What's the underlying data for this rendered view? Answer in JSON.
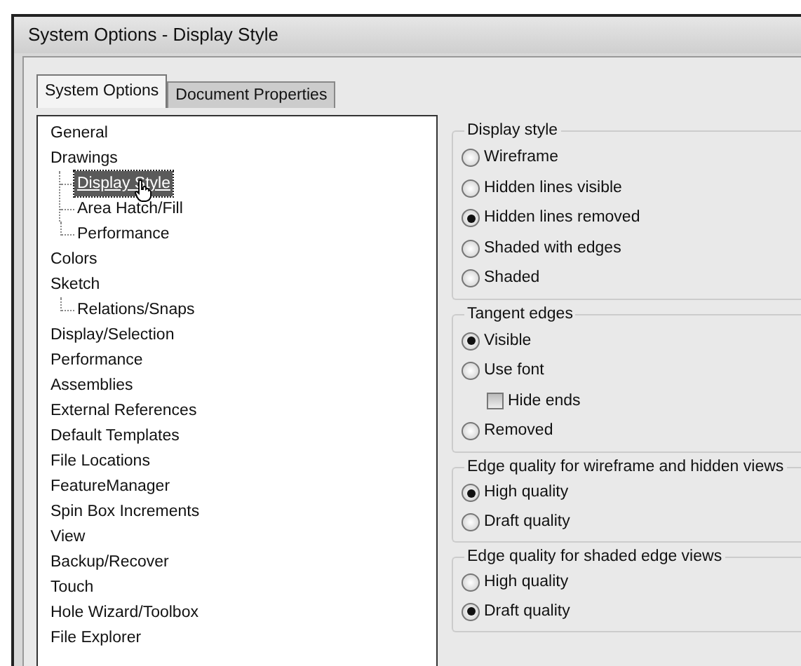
{
  "window": {
    "title": "System Options - Display Style"
  },
  "tabs": [
    {
      "label": "System Options",
      "selected": true
    },
    {
      "label": "Document Properties",
      "selected": false
    }
  ],
  "tree": [
    {
      "label": "General",
      "selected": false
    },
    {
      "label": "Drawings",
      "selected": false,
      "children": [
        {
          "label": "Display Style",
          "selected": true
        },
        {
          "label": "Area Hatch/Fill",
          "selected": false
        },
        {
          "label": "Performance",
          "selected": false
        }
      ]
    },
    {
      "label": "Colors",
      "selected": false
    },
    {
      "label": "Sketch",
      "selected": false,
      "children": [
        {
          "label": "Relations/Snaps",
          "selected": false
        }
      ]
    },
    {
      "label": "Display/Selection",
      "selected": false
    },
    {
      "label": "Performance",
      "selected": false
    },
    {
      "label": "Assemblies",
      "selected": false
    },
    {
      "label": "External References",
      "selected": false
    },
    {
      "label": "Default Templates",
      "selected": false
    },
    {
      "label": "File Locations",
      "selected": false
    },
    {
      "label": "FeatureManager",
      "selected": false
    },
    {
      "label": "Spin Box Increments",
      "selected": false
    },
    {
      "label": "View",
      "selected": false
    },
    {
      "label": "Backup/Recover",
      "selected": false
    },
    {
      "label": "Touch",
      "selected": false
    },
    {
      "label": "Hole Wizard/Toolbox",
      "selected": false
    },
    {
      "label": "File Explorer",
      "selected": false
    }
  ],
  "groups": [
    {
      "title": "Display style",
      "options": [
        {
          "kind": "radio",
          "label": "Wireframe",
          "checked": false
        },
        {
          "kind": "radio",
          "label": "Hidden lines visible",
          "checked": false
        },
        {
          "kind": "radio",
          "label": "Hidden lines removed",
          "checked": true
        },
        {
          "kind": "radio",
          "label": "Shaded with edges",
          "checked": false
        },
        {
          "kind": "radio",
          "label": "Shaded",
          "checked": false
        }
      ]
    },
    {
      "title": "Tangent edges",
      "options": [
        {
          "kind": "radio",
          "label": "Visible",
          "checked": true
        },
        {
          "kind": "radio",
          "label": "Use font",
          "checked": false
        },
        {
          "kind": "checkbox",
          "label": "Hide ends",
          "checked": false
        },
        {
          "kind": "radio",
          "label": "Removed",
          "checked": false
        }
      ]
    },
    {
      "title": "Edge quality for wireframe and hidden views",
      "options": [
        {
          "kind": "radio",
          "label": "High quality",
          "checked": true
        },
        {
          "kind": "radio",
          "label": "Draft quality",
          "checked": false
        }
      ]
    },
    {
      "title": "Edge quality for shaded edge views",
      "options": [
        {
          "kind": "radio",
          "label": "High quality",
          "checked": false
        },
        {
          "kind": "radio",
          "label": "Draft quality",
          "checked": true
        }
      ]
    }
  ]
}
